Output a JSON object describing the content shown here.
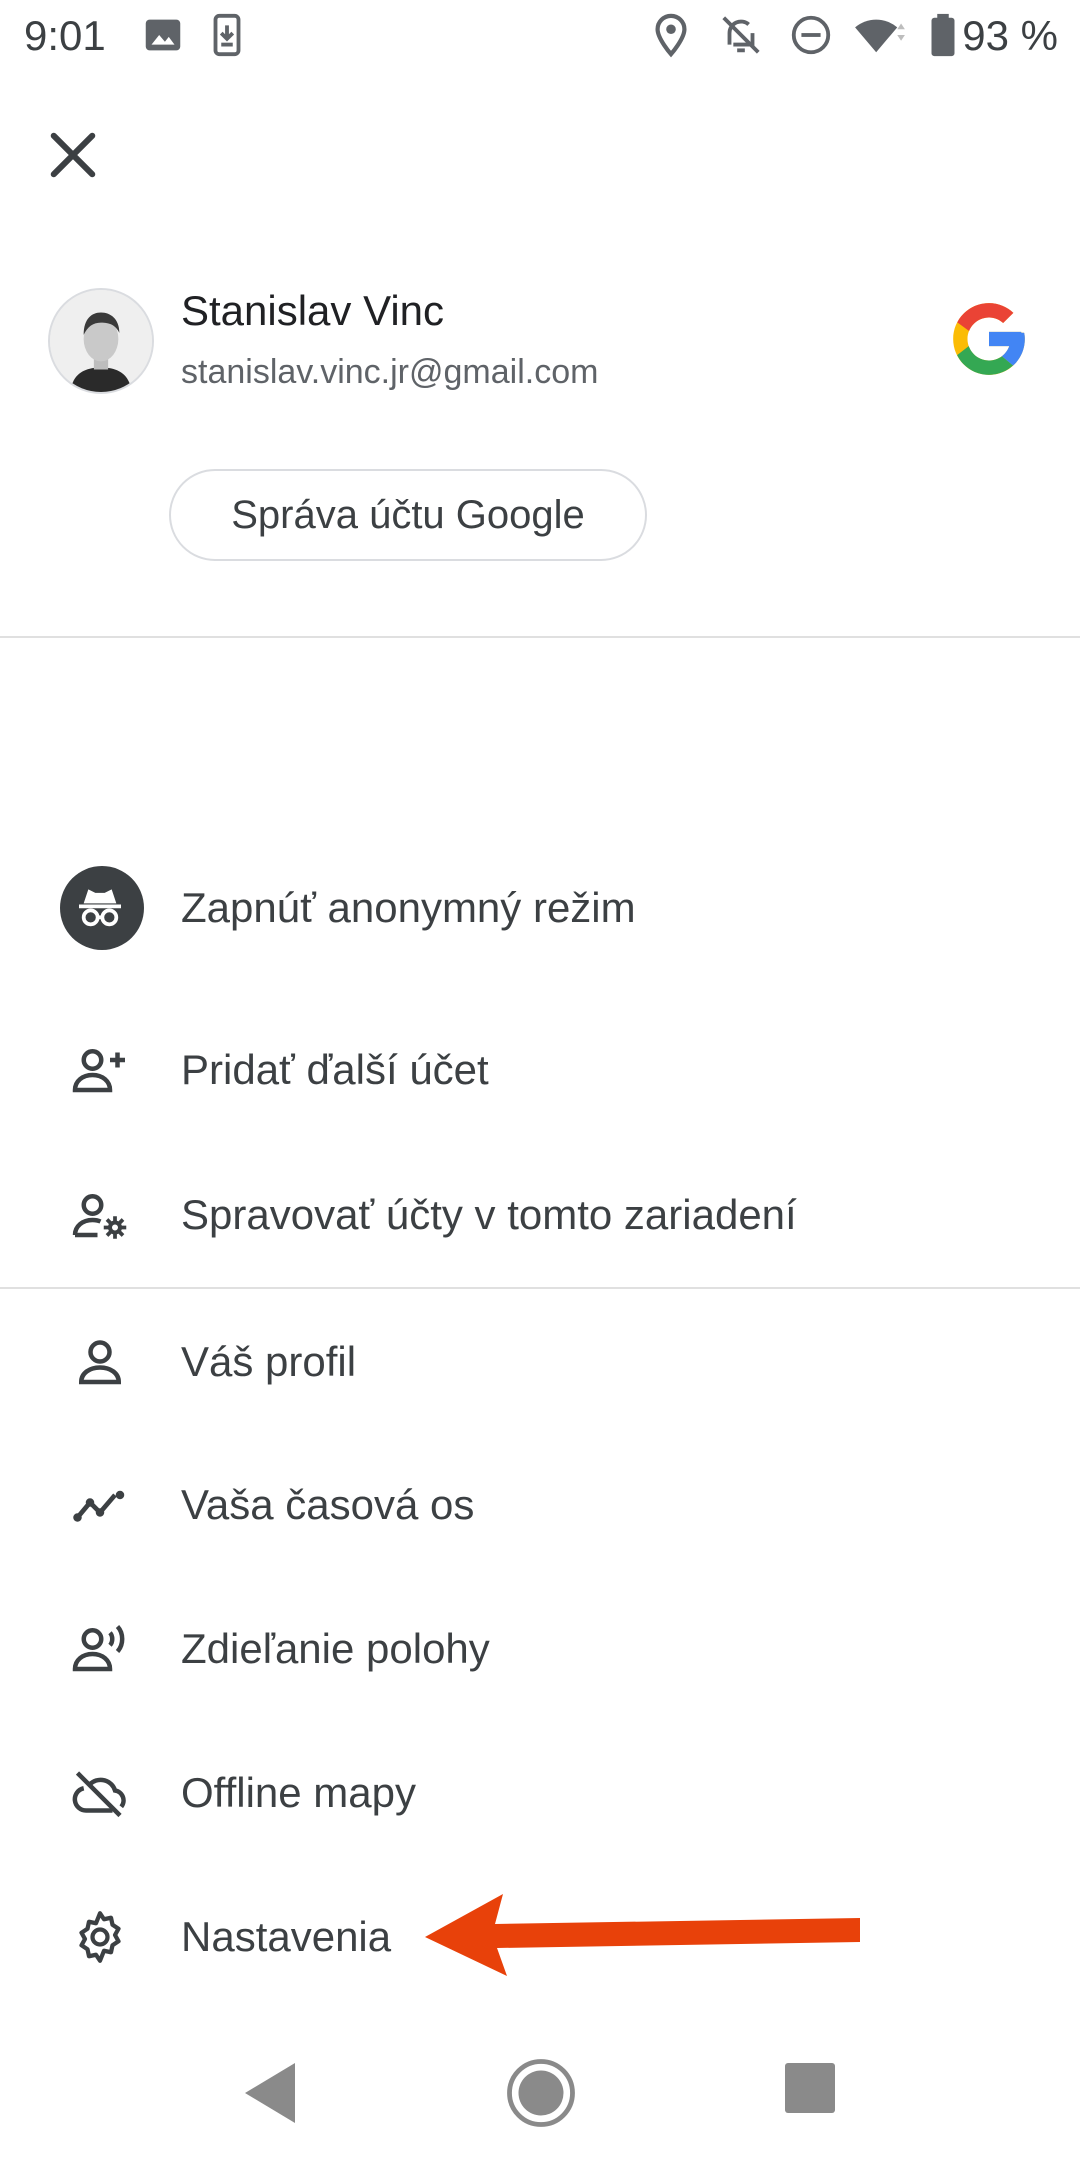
{
  "status_bar": {
    "time": "9:01",
    "battery_percent": "93 %",
    "icons": [
      "image-icon",
      "phone-download-icon",
      "location-icon",
      "bell-off-icon",
      "do-not-disturb-icon",
      "wifi-icon",
      "battery-icon"
    ]
  },
  "header": {
    "close_icon": "close-icon"
  },
  "account": {
    "name": "Stanislav Vinc",
    "email": "stanislav.vinc.jr@gmail.com",
    "manage_button": "Správa účtu Google",
    "logo": "google-g-logo"
  },
  "menu_primary": [
    {
      "icon": "incognito-icon",
      "label": "Zapnúť anonymný režim"
    },
    {
      "icon": "add-person-icon",
      "label": "Pridať ďalší účet"
    },
    {
      "icon": "manage-accounts-icon",
      "label": "Spravovať účty v tomto zariadení"
    }
  ],
  "menu_secondary": [
    {
      "icon": "person-icon",
      "label": "Váš profil"
    },
    {
      "icon": "timeline-icon",
      "label": "Vaša časová os"
    },
    {
      "icon": "location-sharing-icon",
      "label": "Zdieľanie polohy"
    },
    {
      "icon": "cloud-off-icon",
      "label": "Offline mapy"
    },
    {
      "icon": "settings-gear-icon",
      "label": "Nastavenia"
    }
  ],
  "annotation": {
    "arrow_color": "#e8410a"
  },
  "nav_bar": {
    "icons": [
      "back-icon",
      "home-icon",
      "recents-icon"
    ]
  },
  "colors": {
    "text": "#3c4043",
    "secondary_text": "#5f6368",
    "divider": "#e0e0e0",
    "google_blue": "#4285F4",
    "google_red": "#EA4335",
    "google_yellow": "#FBBC05",
    "google_green": "#34A853"
  }
}
